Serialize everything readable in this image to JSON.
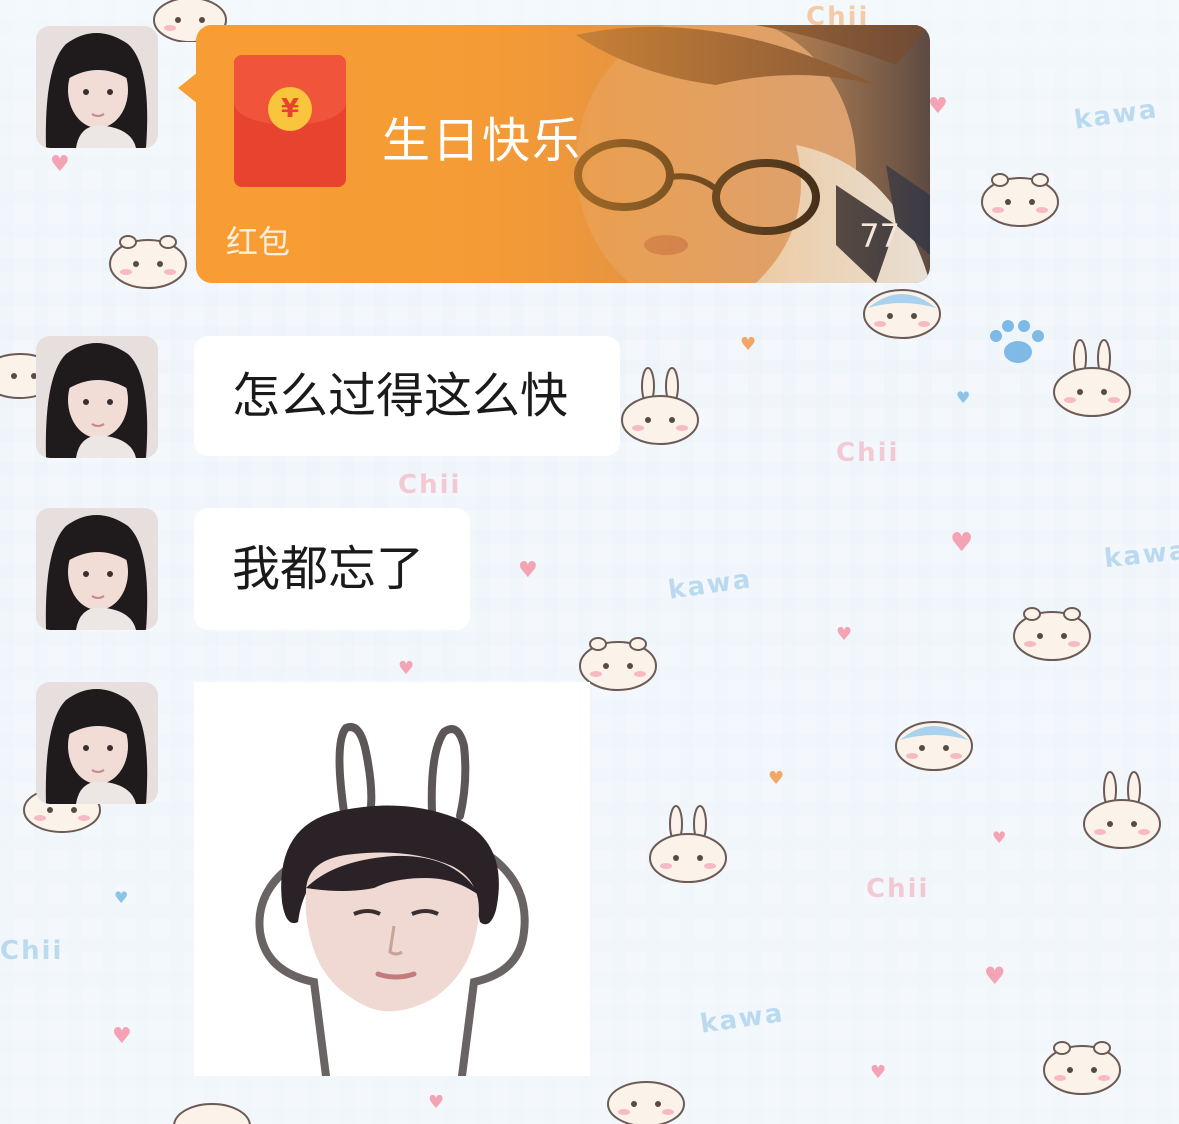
{
  "red_packet": {
    "title": "生日快乐",
    "label": "红包",
    "count": "77",
    "coin_symbol": "¥"
  },
  "messages": [
    {
      "text": "怎么过得这么快"
    },
    {
      "text": "我都忘了"
    }
  ],
  "wallpaper": {
    "words": [
      "Chii",
      "kawa",
      "Chii",
      "kawa",
      "Chii",
      "kawa",
      "kawa",
      "Chii",
      "Chii"
    ],
    "colors": {
      "pink": "#f3a3b4",
      "blue": "#8ec3e8",
      "orange": "#f2a766",
      "bunny": "#fbf3ea"
    }
  },
  "colors": {
    "red_packet_orange": "#f79d34",
    "red_packet_envelope": "#e8432f",
    "coin_gold": "#f9c53c",
    "bubble": "#ffffff",
    "text": "#1a1a1a"
  },
  "icons": {
    "coin": "yen-coin-icon",
    "red_packet": "red-envelope-icon"
  }
}
